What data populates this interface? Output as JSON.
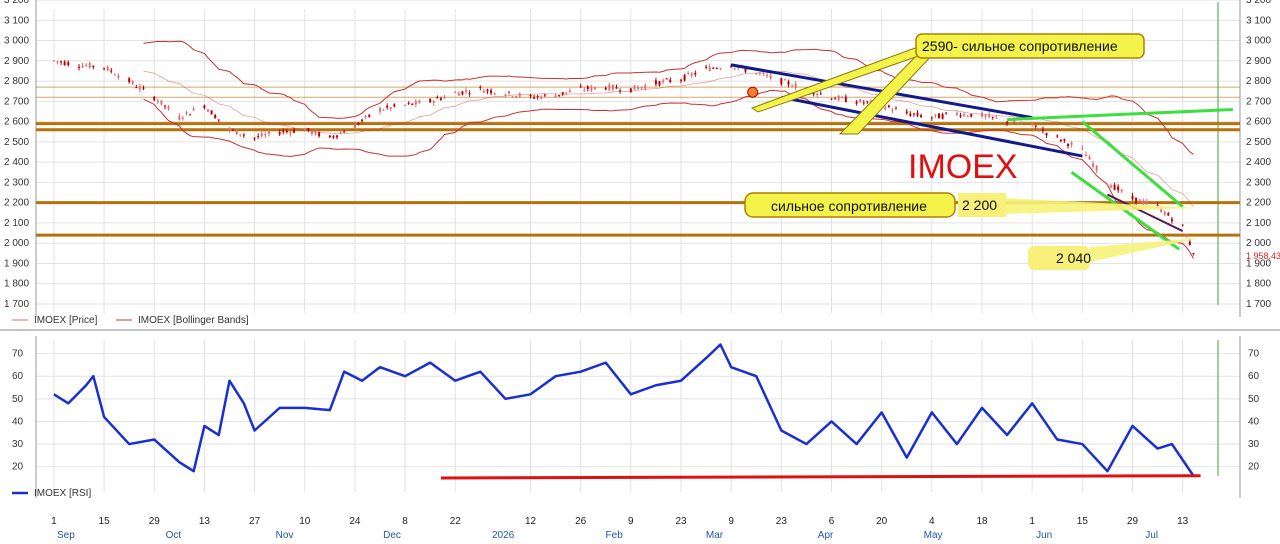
{
  "chart_data": [
    {
      "type": "candlestick",
      "ticker": "IMOEX",
      "ylim": [
        1700,
        3200
      ],
      "y_ticks": [
        "1 700",
        "1 800",
        "1 900",
        "2 000",
        "2 100",
        "2 200",
        "2 300",
        "2 400",
        "2 500",
        "2 600",
        "2 700",
        "2 800",
        "2 900",
        "3 000",
        "3 100",
        "3 200"
      ],
      "y_tick_values": [
        1700,
        1800,
        1900,
        2000,
        2100,
        2200,
        2300,
        2400,
        2500,
        2600,
        2700,
        2800,
        2900,
        3000,
        3100,
        3200
      ],
      "legend": [
        {
          "label": "IMOEX [Price]",
          "color": "#e07070"
        },
        {
          "label": "IMOEX [Bollinger Bands]",
          "color": "#c83232"
        }
      ],
      "title_overlay": "IMOEX",
      "last_price_label": "1 958,43",
      "price_series": [
        [
          "2025-09-01",
          2900
        ],
        [
          "2025-09-08",
          2880
        ],
        [
          "2025-09-15",
          2870
        ],
        [
          "2025-09-22",
          2800
        ],
        [
          "2025-09-29",
          2720
        ],
        [
          "2025-10-06",
          2620
        ],
        [
          "2025-10-13",
          2680
        ],
        [
          "2025-10-20",
          2560
        ],
        [
          "2025-10-27",
          2520
        ],
        [
          "2025-11-03",
          2550
        ],
        [
          "2025-11-10",
          2560
        ],
        [
          "2025-11-17",
          2520
        ],
        [
          "2025-11-24",
          2580
        ],
        [
          "2025-12-01",
          2660
        ],
        [
          "2025-12-08",
          2680
        ],
        [
          "2025-12-15",
          2700
        ],
        [
          "2025-12-22",
          2740
        ],
        [
          "2025-12-29",
          2760
        ],
        [
          "2026-01-05",
          2740
        ],
        [
          "2026-01-12",
          2720
        ],
        [
          "2026-01-19",
          2730
        ],
        [
          "2026-01-26",
          2760
        ],
        [
          "2026-02-02",
          2770
        ],
        [
          "2026-02-09",
          2760
        ],
        [
          "2026-02-16",
          2790
        ],
        [
          "2026-02-23",
          2810
        ],
        [
          "2026-03-02",
          2860
        ],
        [
          "2026-03-09",
          2880
        ],
        [
          "2026-03-16",
          2840
        ],
        [
          "2026-03-23",
          2800
        ],
        [
          "2026-03-30",
          2760
        ],
        [
          "2026-04-06",
          2720
        ],
        [
          "2026-04-13",
          2700
        ],
        [
          "2026-04-20",
          2680
        ],
        [
          "2026-04-27",
          2640
        ],
        [
          "2026-05-04",
          2620
        ],
        [
          "2026-05-11",
          2640
        ],
        [
          "2026-05-18",
          2630
        ],
        [
          "2026-05-25",
          2600
        ],
        [
          "2026-06-01",
          2580
        ],
        [
          "2026-06-08",
          2520
        ],
        [
          "2026-06-15",
          2460
        ],
        [
          "2026-06-22",
          2300
        ],
        [
          "2026-06-29",
          2220
        ],
        [
          "2026-07-06",
          2180
        ],
        [
          "2026-07-13",
          2080
        ],
        [
          "2026-07-16",
          1958
        ]
      ],
      "support_resistance_levels": [
        2040,
        2200,
        2560,
        2590,
        2720,
        2770
      ],
      "annotations": [
        {
          "text": "2590- сильное сопротивление"
        },
        {
          "text": "сильное сопротивление"
        },
        {
          "text": "2 200"
        },
        {
          "text": "2 040"
        }
      ]
    },
    {
      "type": "line",
      "legend": [
        {
          "label": "IMOEX [RSI]",
          "color": "#1a2fd0"
        }
      ],
      "ylim": [
        15,
        76
      ],
      "y_ticks": [
        "20",
        "30",
        "40",
        "50",
        "60",
        "70"
      ],
      "y_tick_values": [
        20,
        30,
        40,
        50,
        60,
        70
      ],
      "rsi_series": [
        [
          "2025-09-01",
          52
        ],
        [
          "2025-09-05",
          48
        ],
        [
          "2025-09-10",
          56
        ],
        [
          "2025-09-12",
          60
        ],
        [
          "2025-09-15",
          42
        ],
        [
          "2025-09-22",
          30
        ],
        [
          "2025-09-29",
          32
        ],
        [
          "2025-10-06",
          22
        ],
        [
          "2025-10-10",
          18
        ],
        [
          "2025-10-13",
          38
        ],
        [
          "2025-10-17",
          34
        ],
        [
          "2025-10-20",
          58
        ],
        [
          "2025-10-24",
          48
        ],
        [
          "2025-10-27",
          36
        ],
        [
          "2025-11-03",
          46
        ],
        [
          "2025-11-10",
          46
        ],
        [
          "2025-11-17",
          45
        ],
        [
          "2025-11-21",
          62
        ],
        [
          "2025-11-26",
          58
        ],
        [
          "2025-12-01",
          64
        ],
        [
          "2025-12-08",
          60
        ],
        [
          "2025-12-15",
          66
        ],
        [
          "2025-12-22",
          58
        ],
        [
          "2025-12-29",
          62
        ],
        [
          "2026-01-05",
          50
        ],
        [
          "2026-01-12",
          52
        ],
        [
          "2026-01-19",
          60
        ],
        [
          "2026-01-26",
          62
        ],
        [
          "2026-02-02",
          66
        ],
        [
          "2026-02-09",
          52
        ],
        [
          "2026-02-16",
          56
        ],
        [
          "2026-02-23",
          58
        ],
        [
          "2026-03-02",
          68
        ],
        [
          "2026-03-06",
          74
        ],
        [
          "2026-03-09",
          64
        ],
        [
          "2026-03-16",
          60
        ],
        [
          "2026-03-23",
          36
        ],
        [
          "2026-03-30",
          30
        ],
        [
          "2026-04-06",
          40
        ],
        [
          "2026-04-13",
          30
        ],
        [
          "2026-04-20",
          44
        ],
        [
          "2026-04-27",
          24
        ],
        [
          "2026-05-04",
          44
        ],
        [
          "2026-05-11",
          30
        ],
        [
          "2026-05-18",
          46
        ],
        [
          "2026-05-25",
          34
        ],
        [
          "2026-06-01",
          48
        ],
        [
          "2026-06-08",
          32
        ],
        [
          "2026-06-15",
          30
        ],
        [
          "2026-06-22",
          18
        ],
        [
          "2026-06-29",
          38
        ],
        [
          "2026-07-06",
          28
        ],
        [
          "2026-07-10",
          30
        ],
        [
          "2026-07-16",
          16
        ]
      ],
      "trendline": [
        [
          "2025-12-18",
          15
        ],
        [
          "2026-07-18",
          16
        ]
      ]
    }
  ],
  "x_axis": {
    "day_ticks": [
      {
        "label": "1",
        "date": "2025-09-01"
      },
      {
        "label": "15",
        "date": "2025-09-15"
      },
      {
        "label": "29",
        "date": "2025-09-29"
      },
      {
        "label": "13",
        "date": "2025-10-13"
      },
      {
        "label": "27",
        "date": "2025-10-27"
      },
      {
        "label": "10",
        "date": "2025-11-10"
      },
      {
        "label": "24",
        "date": "2025-11-24"
      },
      {
        "label": "8",
        "date": "2025-12-08"
      },
      {
        "label": "22",
        "date": "2025-12-22"
      },
      {
        "label": "12",
        "date": "2026-01-12"
      },
      {
        "label": "26",
        "date": "2026-01-26"
      },
      {
        "label": "9",
        "date": "2026-02-09"
      },
      {
        "label": "23",
        "date": "2026-02-23"
      },
      {
        "label": "9",
        "date": "2026-03-09"
      },
      {
        "label": "23",
        "date": "2026-03-23"
      },
      {
        "label": "6",
        "date": "2026-04-06"
      },
      {
        "label": "20",
        "date": "2026-04-20"
      },
      {
        "label": "4",
        "date": "2026-05-04"
      },
      {
        "label": "18",
        "date": "2026-05-18"
      },
      {
        "label": "1",
        "date": "2026-06-01"
      },
      {
        "label": "15",
        "date": "2026-06-15"
      },
      {
        "label": "29",
        "date": "2026-06-29"
      },
      {
        "label": "13",
        "date": "2026-07-13"
      }
    ],
    "month_labels": [
      {
        "label": "Sep",
        "date": "2025-09-01"
      },
      {
        "label": "Oct",
        "date": "2025-10-01"
      },
      {
        "label": "Nov",
        "date": "2025-11-01"
      },
      {
        "label": "Dec",
        "date": "2025-12-01"
      },
      {
        "label": "2026",
        "date": "2026-01-01"
      },
      {
        "label": "Feb",
        "date": "2026-02-01"
      },
      {
        "label": "Mar",
        "date": "2026-03-01"
      },
      {
        "label": "Apr",
        "date": "2026-04-01"
      },
      {
        "label": "May",
        "date": "2026-05-01"
      },
      {
        "label": "Jun",
        "date": "2026-06-01"
      },
      {
        "label": "Jul",
        "date": "2026-07-01"
      }
    ]
  },
  "colors": {
    "candle_up": "#e07070",
    "candle_down": "#c00000",
    "bollinger": "#c83232",
    "support": "#b8700a",
    "channel_blue": "#101a8a",
    "channel_green": "#3ce03c",
    "callout_fill": "#f3f34a",
    "callout_border": "#b08000",
    "rsi_line": "#1a2fd0",
    "rsi_trend": "#e01010",
    "grid": "#e2e2e2",
    "cursor": "#33aa33"
  }
}
